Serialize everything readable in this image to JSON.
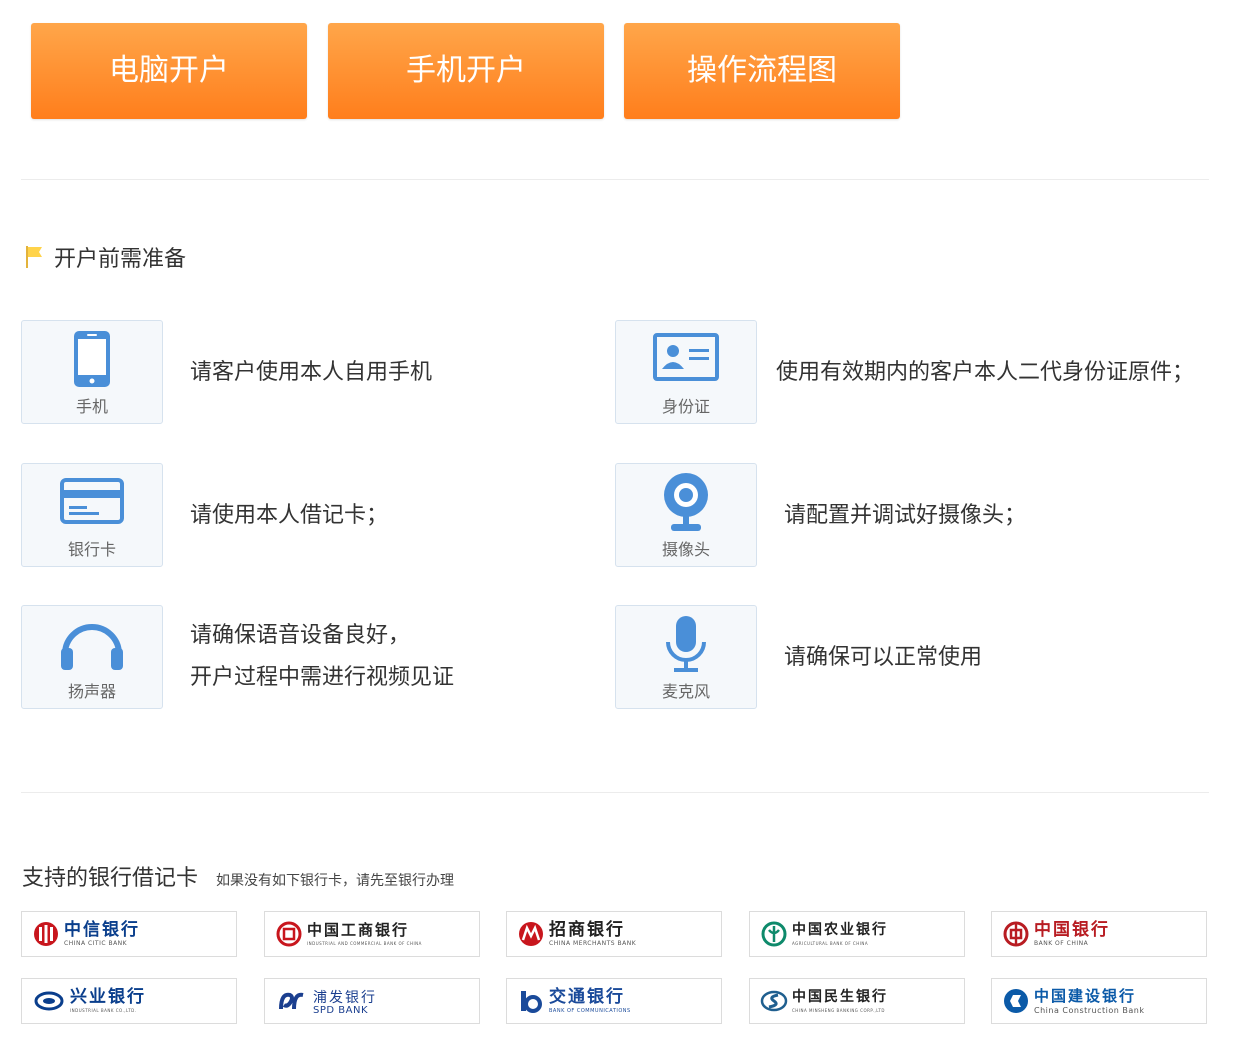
{
  "top_buttons": [
    "电脑开户",
    "手机开户",
    "操作流程图"
  ],
  "prep": {
    "title": "开户前需准备",
    "items": [
      {
        "label": "手机",
        "icon": "phone-icon",
        "desc": [
          "请客户使用本人自用手机"
        ]
      },
      {
        "label": "身份证",
        "icon": "id-card-icon",
        "desc": [
          "使用有效期内的客户本人二代身份证原件；"
        ]
      },
      {
        "label": "银行卡",
        "icon": "bank-card-icon",
        "desc": [
          "请使用本人借记卡；"
        ]
      },
      {
        "label": "摄像头",
        "icon": "webcam-icon",
        "desc": [
          "请配置并调试好摄像头；"
        ]
      },
      {
        "label": "扬声器",
        "icon": "headphones-icon",
        "desc": [
          "请确保语音设备良好，",
          "开户过程中需进行视频见证"
        ]
      },
      {
        "label": "麦克风",
        "icon": "microphone-icon",
        "desc": [
          "请确保可以正常使用"
        ]
      }
    ]
  },
  "banks": {
    "title": "支持的银行借记卡",
    "note": "如果没有如下银行卡，请先至银行办理",
    "list": [
      {
        "cn": "中信银行",
        "en": "CHINA CITIC BANK",
        "color": "#c8161d"
      },
      {
        "cn": "中国工商银行",
        "en": "INDUSTRIAL AND COMMERCIAL BANK OF CHINA",
        "color": "#c8161d"
      },
      {
        "cn": "招商银行",
        "en": "CHINA MERCHANTS BANK",
        "color": "#c8161d"
      },
      {
        "cn": "中国农业银行",
        "en": "AGRICULTURAL BANK OF CHINA",
        "color": "#0e8a6b"
      },
      {
        "cn": "中国银行",
        "en": "BANK OF CHINA",
        "color": "#b81c22"
      },
      {
        "cn": "兴业银行",
        "en": "INDUSTRIAL BANK CO.,LTD.",
        "color": "#0a3e8c"
      },
      {
        "cn": "浦发银行",
        "en": "SPD BANK",
        "color": "#1b3f8f"
      },
      {
        "cn": "交通银行",
        "en": "BANK OF COMMUNICATIONS",
        "color": "#1a4a9a"
      },
      {
        "cn": "中国民生银行",
        "en": "CHINA MINSHENG BANKING CORP.,LTD",
        "color": "#1f5f8f"
      },
      {
        "cn": "中国建设银行",
        "en": "China Construction Bank",
        "color": "#0b5aa8"
      }
    ]
  },
  "colors": {
    "accent": "#ff8a2a",
    "icon_blue": "#4a8fd8"
  }
}
